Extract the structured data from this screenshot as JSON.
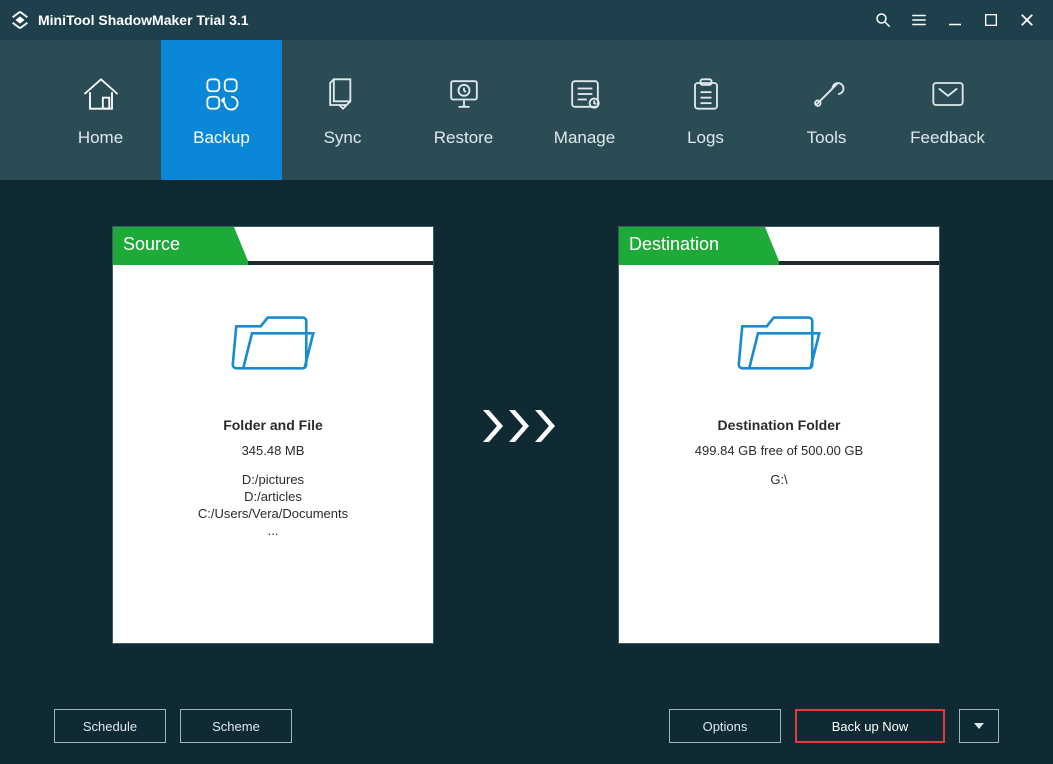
{
  "titlebar": {
    "title": "MiniTool ShadowMaker Trial 3.1"
  },
  "nav": {
    "items": [
      {
        "label": "Home"
      },
      {
        "label": "Backup"
      },
      {
        "label": "Sync"
      },
      {
        "label": "Restore"
      },
      {
        "label": "Manage"
      },
      {
        "label": "Logs"
      },
      {
        "label": "Tools"
      },
      {
        "label": "Feedback"
      }
    ]
  },
  "source": {
    "flag": "Source",
    "heading": "Folder and File",
    "size": "345.48 MB",
    "paths": [
      "D:/pictures",
      "D:/articles",
      "C:/Users/Vera/Documents",
      "..."
    ]
  },
  "destination": {
    "flag": "Destination",
    "heading": "Destination Folder",
    "freeline": "499.84 GB free of 500.00 GB",
    "drive": "G:\\"
  },
  "buttons": {
    "schedule": "Schedule",
    "scheme": "Scheme",
    "options": "Options",
    "backup_now": "Back up Now"
  }
}
